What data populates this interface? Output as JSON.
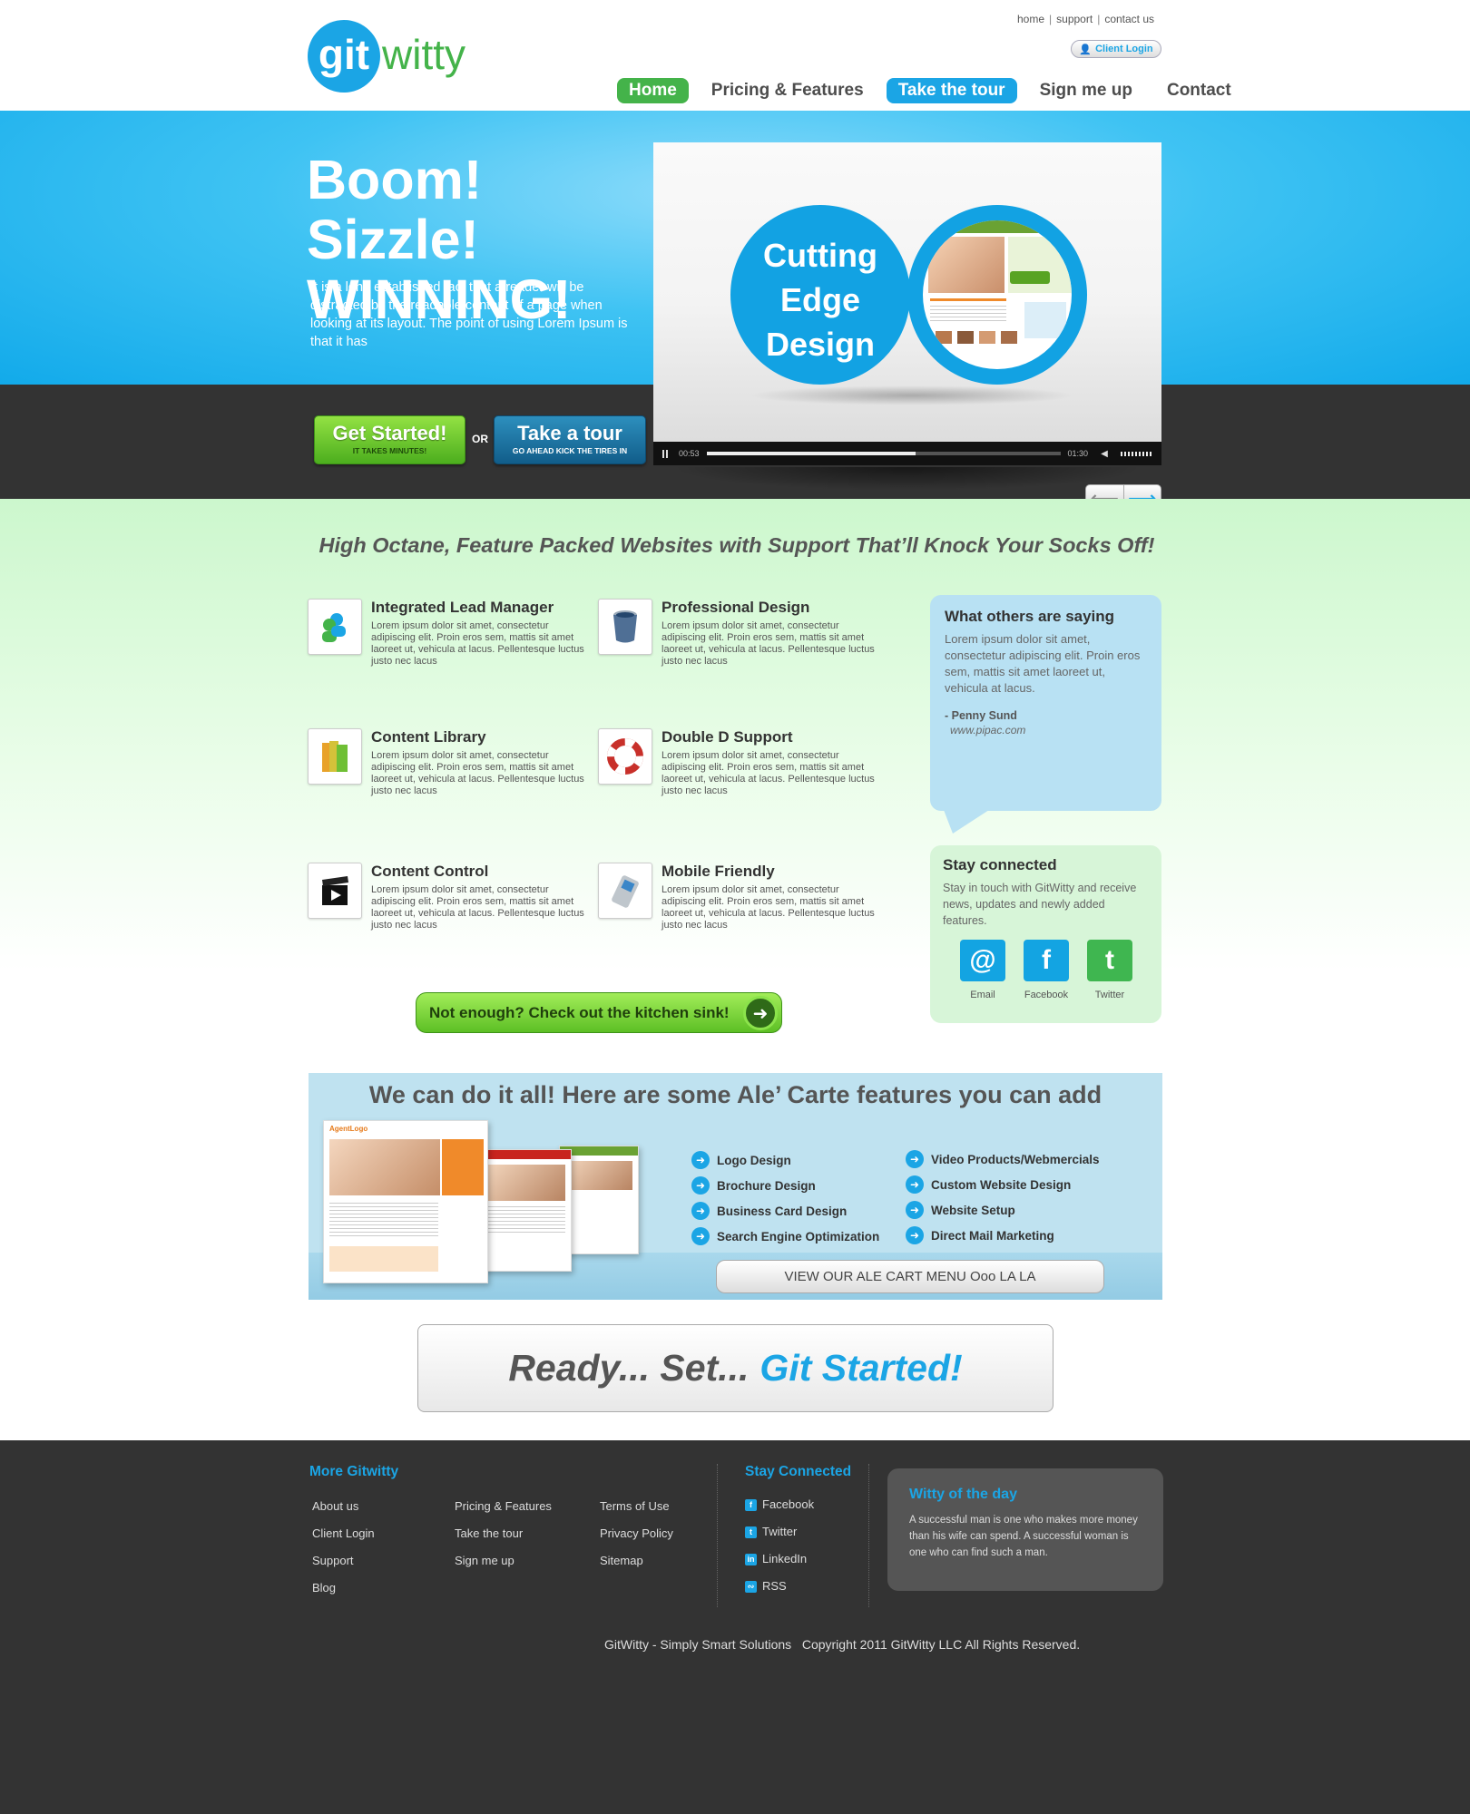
{
  "top_links": {
    "home": "home",
    "support": "support",
    "contact": "contact us"
  },
  "logo": {
    "part1": "git",
    "part2": "witty"
  },
  "client_login": "Client Login",
  "nav": [
    "Home",
    "Pricing & Features",
    "Take the tour",
    "Sign me up",
    "Contact"
  ],
  "hero": {
    "title_line1": "Boom! Sizzle!",
    "title_line2": "WINNING!",
    "text": "It is a long established fact that a reader will be distracted by the readable content of a page when looking at its layout. The point of using Lorem Ipsum is that it has",
    "get_started": "Get Started!",
    "get_started_sub": "IT TAKES MINUTES!",
    "or": "OR",
    "take_tour": "Take a tour",
    "take_tour_sub": "GO AHEAD KICK THE TIRES IN"
  },
  "video": {
    "circle_line1": "Cutting",
    "circle_line2": "Edge",
    "circle_line3": "Design",
    "elapsed": "00:53",
    "duration": "01:30",
    "progress": 0.59
  },
  "tagline": "High Octane, Feature Packed Websites with Support That’ll Knock Your Socks Off!",
  "features": [
    {
      "title": "Integrated Lead Manager",
      "text": "Lorem ipsum dolor sit amet, consectetur adipiscing elit. Proin eros sem, mattis sit amet laoreet ut, vehicula at lacus. Pellentesque luctus justo nec lacus",
      "icon": "users-icon"
    },
    {
      "title": "Professional Design",
      "text": "Lorem ipsum dolor sit amet, consectetur adipiscing elit. Proin eros sem, mattis sit amet laoreet ut, vehicula at lacus. Pellentesque luctus justo nec lacus",
      "icon": "paint-bucket-icon"
    },
    {
      "title": "Content Library",
      "text": "Lorem ipsum dolor sit amet, consectetur adipiscing elit. Proin eros sem, mattis sit amet laoreet ut, vehicula at lacus. Pellentesque luctus justo nec lacus",
      "icon": "books-icon"
    },
    {
      "title": "Double D Support",
      "text": "Lorem ipsum dolor sit amet, consectetur adipiscing elit. Proin eros sem, mattis sit amet laoreet ut, vehicula at lacus. Pellentesque luctus justo nec lacus",
      "icon": "lifebuoy-icon"
    },
    {
      "title": "Content Control",
      "text": "Lorem ipsum dolor sit amet, consectetur adipiscing elit. Proin eros sem, mattis sit amet laoreet ut, vehicula at lacus. Pellentesque luctus justo nec lacus",
      "icon": "clapperboard-icon"
    },
    {
      "title": "Mobile Friendly",
      "text": "Lorem ipsum dolor sit amet, consectetur adipiscing elit. Proin eros sem, mattis sit amet laoreet ut, vehicula at lacus. Pellentesque luctus justo nec lacus",
      "icon": "mobile-phone-icon"
    }
  ],
  "testimonial": {
    "heading": "What others are saying",
    "text": "Lorem ipsum dolor sit amet, consectetur adipiscing elit. Proin eros sem, mattis sit amet laoreet ut, vehicula at lacus.",
    "author": "- Penny Sund",
    "url": "www.pipac.com"
  },
  "stay_connected": {
    "heading": "Stay connected",
    "text": "Stay in touch with GitWitty and receive news, updates and newly added features.",
    "email": "Email",
    "facebook": "Facebook",
    "twitter": "Twitter"
  },
  "kitchen_sink": "Not enough? Check out the kitchen sink!",
  "ale_carte": {
    "title": "We can do it all! Here are some Ale’ Carte features you can add",
    "items_left": [
      "Logo Design",
      "Brochure Design",
      "Business Card Design",
      "Search Engine Optimization"
    ],
    "items_right": [
      "Video Products/Webmercials",
      "Custom Website Design",
      "Website Setup",
      "Direct Mail Marketing"
    ],
    "cta": "VIEW OUR ALE CART MENU Ooo LA LA",
    "mock_logo": "AgentLogo"
  },
  "ready": {
    "part1": "Ready... Set...",
    "part2": "Git Started!"
  },
  "footer": {
    "more_heading": "More Gitwitty",
    "col1": [
      "About us",
      "Client Login",
      "Support",
      "Blog"
    ],
    "col2": [
      "Pricing & Features",
      "Take the tour",
      "Sign me up"
    ],
    "col3": [
      "Terms of Use",
      "Privacy Policy",
      "Sitemap"
    ],
    "stay_heading": "Stay Connected",
    "social": [
      "Facebook",
      "Twitter",
      "LinkedIn",
      "RSS"
    ],
    "witty_heading": "Witty of the day",
    "witty_text": "A successful man is one who makes more money than his wife can spend. A successful woman is one who can find such a man.",
    "brand": "GitWitty -  Simply Smart Solutions",
    "copyright": "Copyright 2011 GitWitty LLC All Rights Reserved."
  },
  "colors": {
    "accent_blue": "#1ba5e5",
    "accent_green": "#44b34a",
    "dark": "#333333"
  }
}
